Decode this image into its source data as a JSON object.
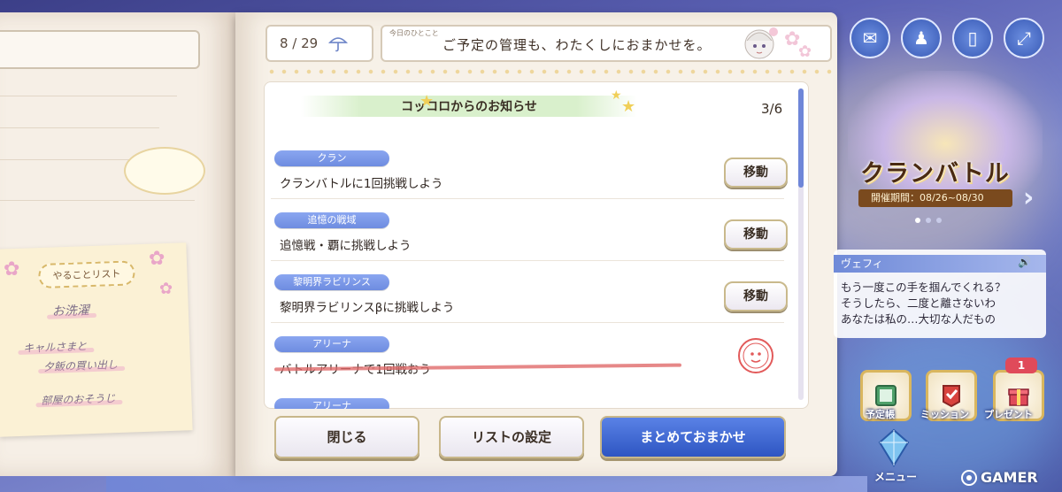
{
  "header": {
    "date": "8 / 29",
    "message_label": "今日のひとこと",
    "message": "ご予定の管理も、わたくしにおまかせを。"
  },
  "notice": {
    "title": "コッコロからのお知らせ",
    "page": "3/6"
  },
  "tasks": [
    {
      "tag": "クラン",
      "text": "クランバトルに1回挑戦しよう",
      "action": "移動",
      "done": false
    },
    {
      "tag": "追憶の戦域",
      "text": "追憶戦・覇に挑戦しよう",
      "action": "移動",
      "done": false
    },
    {
      "tag": "黎明界ラビリンス",
      "text": "黎明界ラビリンスβに挑戦しよう",
      "action": "移動",
      "done": false
    },
    {
      "tag": "アリーナ",
      "text": "バトルアリーナで1回戦おう",
      "action": "",
      "done": true
    },
    {
      "tag": "アリーナ",
      "text": "",
      "action": "",
      "done": false
    }
  ],
  "buttons": {
    "close": "閉じる",
    "list_settings": "リストの設定",
    "auto_all": "まとめておまかせ"
  },
  "left_page": {
    "todo_title": "やることリスト",
    "todo_items": [
      "お洗濯",
      "キャルさまと",
      "夕飯の買い出し",
      "部屋のおそうじ"
    ]
  },
  "hud": {
    "top_icons": [
      "mail-icon",
      "character-icon",
      "album-icon",
      "fullscreen-icon"
    ],
    "event_title": "クランバトル",
    "event_period": "開催期間：08/26~08/30",
    "dialog_name": "ヴェフィ",
    "dialog_lines": [
      "もう一度この手を掴んでくれる？",
      "そうしたら、二度と離さないわ",
      "あなたは私の…大切な人だもの"
    ],
    "menu": [
      {
        "label": "予定帳",
        "icon": "planner-icon"
      },
      {
        "label": "ミッション",
        "icon": "mission-icon"
      },
      {
        "label": "プレゼント",
        "icon": "present-icon",
        "badge": "1"
      }
    ],
    "main_menu": "メニュー",
    "watermark": "GAMER"
  },
  "colors": {
    "accent_blue": "#2e55c2",
    "tag_blue": "#7a98e8",
    "strike_red": "#e06a6a",
    "page_bg": "#f7f1e8"
  }
}
